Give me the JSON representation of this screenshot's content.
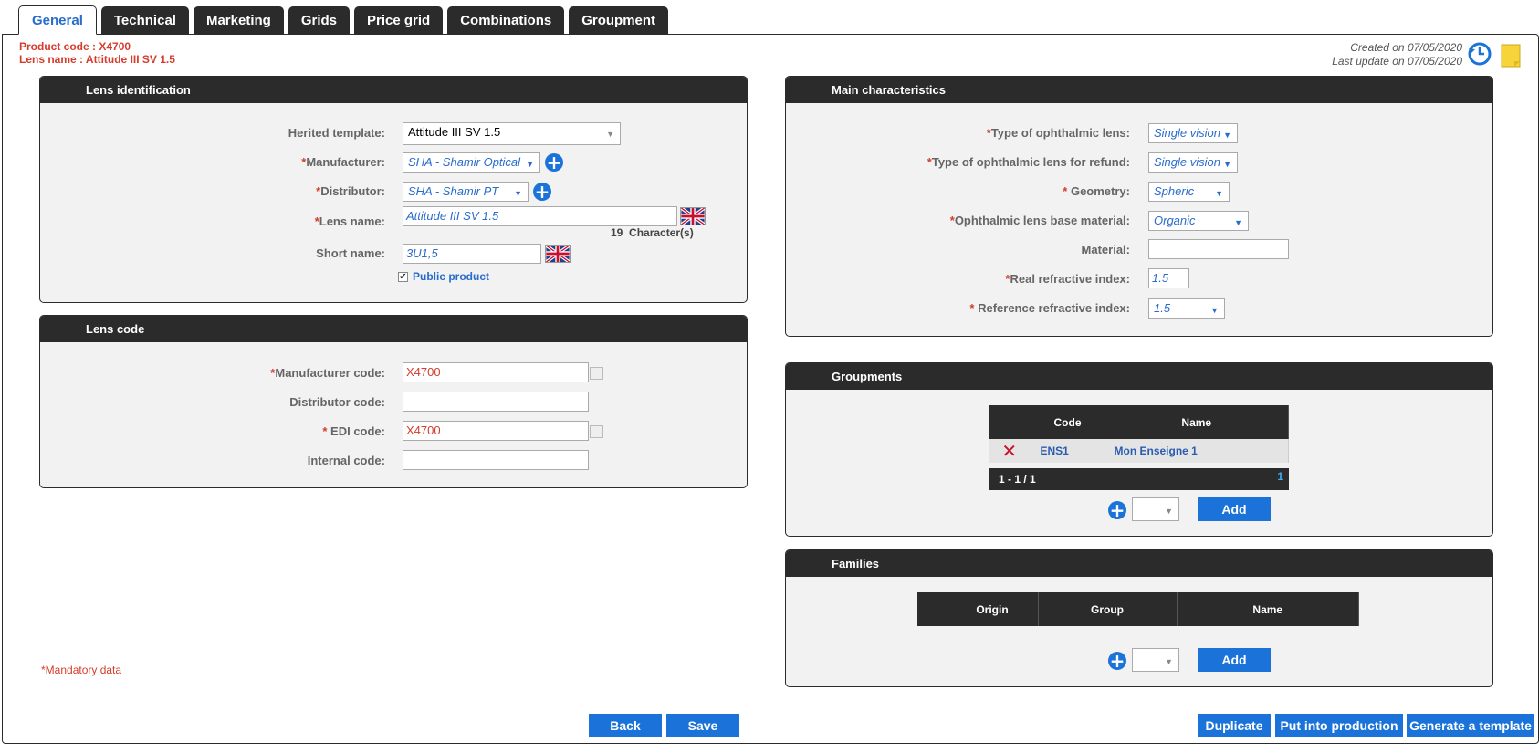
{
  "tabs": [
    {
      "label": "General",
      "active": true
    },
    {
      "label": "Technical"
    },
    {
      "label": "Marketing"
    },
    {
      "label": "Grids"
    },
    {
      "label": "Price grid"
    },
    {
      "label": "Combinations"
    },
    {
      "label": "Groupment"
    }
  ],
  "header": {
    "product_code": "Product code : X4700",
    "lens_name": "Lens name : Attitude III SV 1.5",
    "created": "Created on 07/05/2020",
    "updated": "Last update on 07/05/2020"
  },
  "lens_identification": {
    "title": "Lens identification",
    "herited_label": "Herited template:",
    "herited_value": "Attitude III SV 1.5",
    "manufacturer_label": "Manufacturer:",
    "manufacturer_value": "SHA - Shamir Optical",
    "distributor_label": "Distributor:",
    "distributor_value": "SHA - Shamir PT",
    "lens_name_label": "Lens name:",
    "lens_name_value": "Attitude III SV 1.5",
    "char_count": "19",
    "char_label": "Character(s)",
    "short_name_label": "Short name:",
    "short_name_value": "3U1,5",
    "public_label": "Public product"
  },
  "lens_code": {
    "title": "Lens code",
    "manufacturer_code_label": "Manufacturer code:",
    "manufacturer_code_value": "X4700",
    "distributor_code_label": "Distributor code:",
    "distributor_code_value": "",
    "edi_code_label": "EDI code:",
    "edi_code_value": "X4700",
    "internal_code_label": "Internal code:",
    "internal_code_value": ""
  },
  "main_characteristics": {
    "title": "Main characteristics",
    "type_label": "Type of ophthalmic lens:",
    "type_value": "Single vision",
    "type_refund_label": "Type of ophthalmic lens for refund:",
    "type_refund_value": "Single vision",
    "geometry_label": "Geometry:",
    "geometry_value": "Spheric",
    "base_material_label": "Ophthalmic lens base material:",
    "base_material_value": "Organic",
    "material_label": "Material:",
    "material_value": "",
    "real_index_label": "Real refractive index:",
    "real_index_value": "1.5",
    "ref_index_label": "Reference refractive index:",
    "ref_index_value": "1.5"
  },
  "groupments": {
    "title": "Groupments",
    "col_code": "Code",
    "col_name": "Name",
    "rows": [
      {
        "code": "ENS1",
        "name": "Mon Enseigne 1"
      }
    ],
    "pager": "1 - 1 / 1",
    "page": "1",
    "add_label": "Add"
  },
  "families": {
    "title": "Families",
    "col_origin": "Origin",
    "col_group": "Group",
    "col_name": "Name",
    "add_label": "Add"
  },
  "footer": {
    "mandatory": "*Mandatory data",
    "back": "Back",
    "save": "Save",
    "duplicate": "Duplicate",
    "production": "Put into production",
    "template": "Generate a template"
  },
  "colors": {
    "accent": "#1b73d9",
    "header_bg": "#2b2b2b",
    "required": "#d43c2c"
  }
}
